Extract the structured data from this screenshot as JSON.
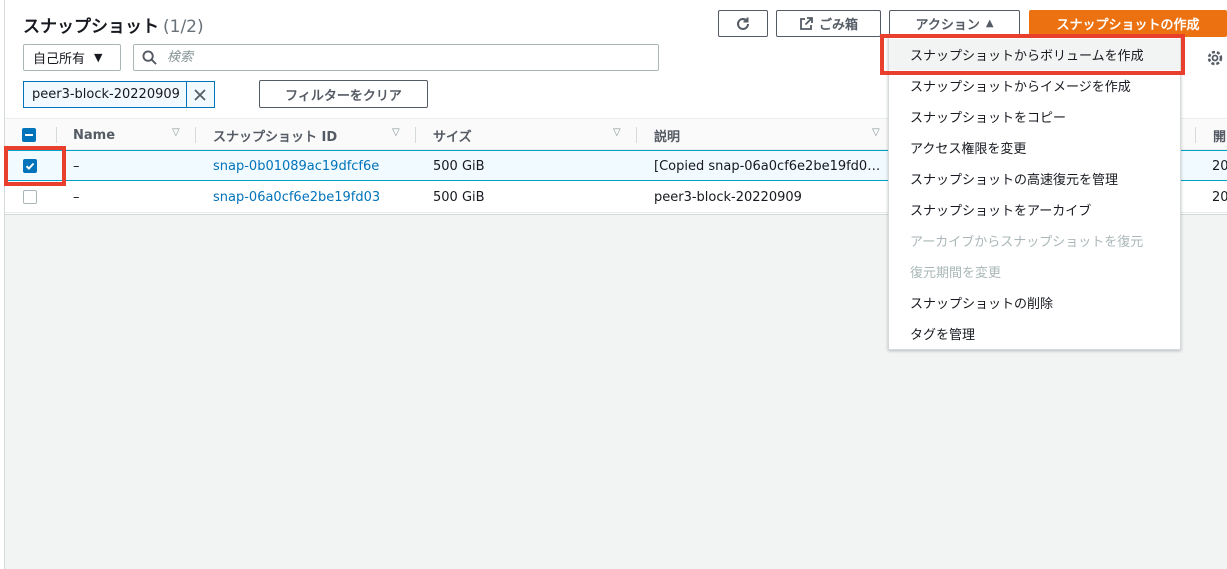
{
  "header": {
    "title": "スナップショット",
    "count": "(1/2)",
    "refresh_icon": "refresh-icon",
    "recycle_label": "ごみ箱",
    "actions_label": "アクション",
    "create_label": "スナップショットの作成"
  },
  "filters": {
    "owner_select": "自己所有",
    "search_placeholder": "検索",
    "token_label": "peer3-block-20220909",
    "clear_label": "フィルターをクリア"
  },
  "table": {
    "columns": [
      "Name",
      "スナップショット ID",
      "サイズ",
      "説明",
      "開"
    ],
    "rows": [
      {
        "name": "–",
        "id": "snap-0b01089ac19dfcf6e",
        "size": "500 GiB",
        "desc": "[Copied snap-06a0cf6e2be19fd0…",
        "start": "20",
        "checked": true
      },
      {
        "name": "–",
        "id": "snap-06a0cf6e2be19fd03",
        "size": "500 GiB",
        "desc": "peer3-block-20220909",
        "start": "20",
        "checked": false
      }
    ]
  },
  "menu": {
    "items": [
      {
        "label": "スナップショットからボリュームを作成",
        "disabled": false,
        "highlighted": true
      },
      {
        "label": "スナップショットからイメージを作成",
        "disabled": false
      },
      {
        "label": "スナップショットをコピー",
        "disabled": false
      },
      {
        "label": "アクセス権限を変更",
        "disabled": false
      },
      {
        "label": "スナップショットの高速復元を管理",
        "disabled": false
      },
      {
        "label": "スナップショットをアーカイブ",
        "disabled": false
      },
      {
        "label": "アーカイブからスナップショットを復元",
        "disabled": true
      },
      {
        "label": "復元期間を変更",
        "disabled": true
      },
      {
        "label": "スナップショットの削除",
        "disabled": false
      },
      {
        "label": "タグを管理",
        "disabled": false
      }
    ]
  },
  "colors": {
    "accent": "#0073bb",
    "primary_button": "#ec7211",
    "highlight_box": "#e8402c"
  }
}
